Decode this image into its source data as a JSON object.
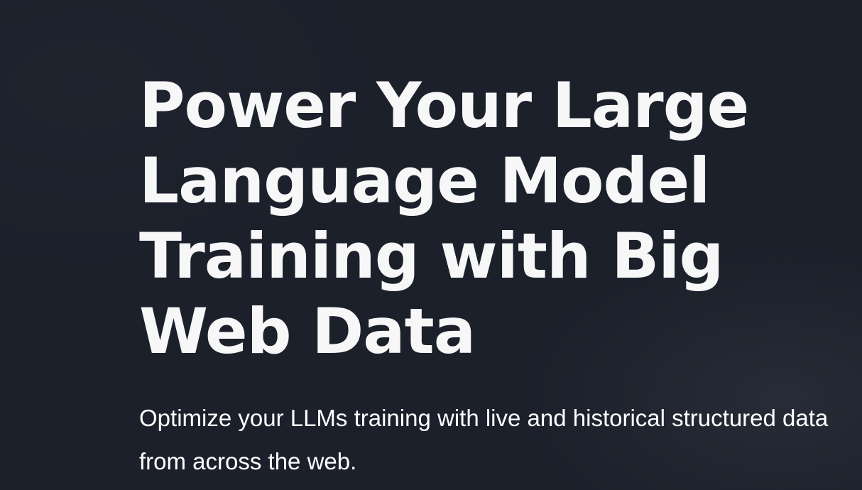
{
  "hero": {
    "title_lines": [
      "Power Your Large",
      "Language Model",
      "Training with Big",
      "Web Data"
    ],
    "subtitle": "Optimize your LLMs training with live and historical structured data from across the web."
  },
  "colors": {
    "background": "#1b202b",
    "title": "#f7f7f8",
    "subtitle": "#ffffff"
  }
}
